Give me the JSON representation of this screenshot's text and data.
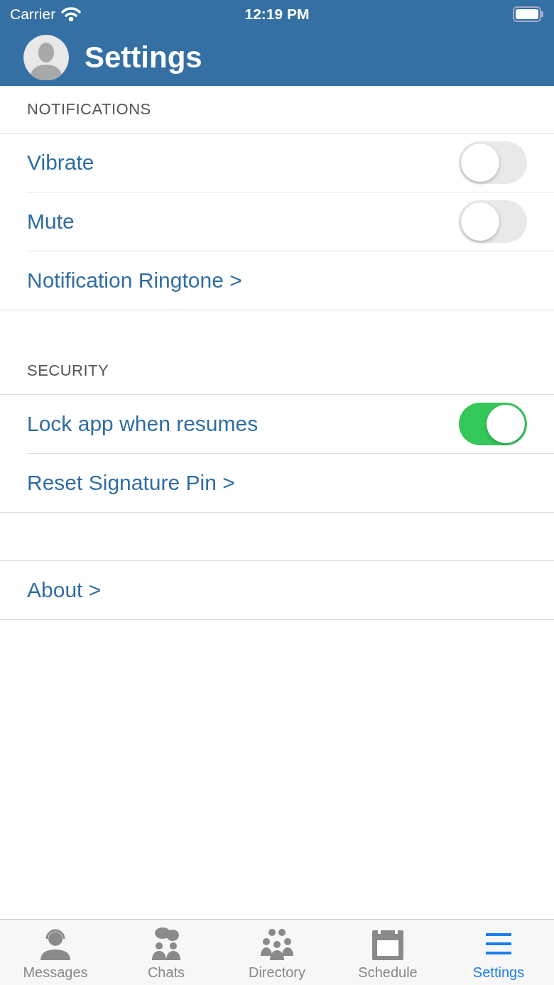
{
  "status_bar": {
    "carrier": "Carrier",
    "time": "12:19 PM"
  },
  "header": {
    "title": "Settings"
  },
  "sections": [
    {
      "title": "NOTIFICATIONS",
      "rows": [
        {
          "kind": "toggle",
          "label": "Vibrate",
          "on": false
        },
        {
          "kind": "toggle",
          "label": "Mute",
          "on": false
        },
        {
          "kind": "link",
          "label": "Notification Ringtone >"
        }
      ]
    },
    {
      "title": "SECURITY",
      "rows": [
        {
          "kind": "toggle",
          "label": "Lock app when resumes",
          "on": true
        },
        {
          "kind": "link",
          "label": "Reset Signature Pin >"
        }
      ]
    },
    {
      "rows": [
        {
          "kind": "link",
          "label": "About >"
        }
      ]
    }
  ],
  "tab_bar": [
    {
      "label": "Messages",
      "kind": "agent",
      "selected": false
    },
    {
      "label": "Chats",
      "kind": "chats",
      "selected": false
    },
    {
      "label": "Directory",
      "kind": "group",
      "selected": false
    },
    {
      "label": "Schedule",
      "kind": "calendar",
      "selected": false
    },
    {
      "label": "Settings",
      "kind": "menu",
      "selected": true
    }
  ]
}
